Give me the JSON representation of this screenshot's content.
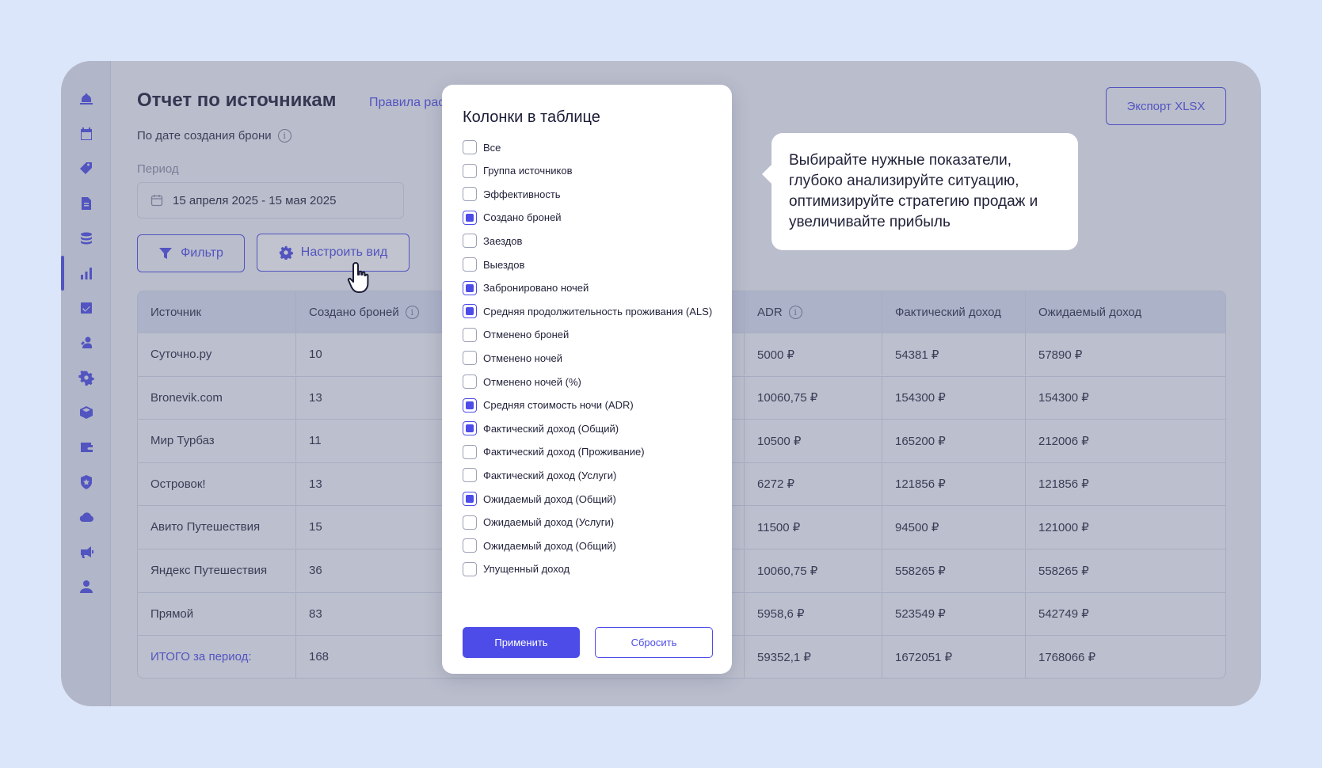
{
  "report": {
    "title": "Отчет по источникам",
    "rules_link": "Правила расч",
    "subtitle": "По дате создания брони",
    "period_label": "Период",
    "period_value": "15 апреля 2025 - 15 мая 2025",
    "filter_button": "Фильтр",
    "configure_button": "Настроить вид",
    "export_button": "Экспорт XLSX"
  },
  "sidebar": {
    "icons": [
      "bell-icon",
      "calendar-icon",
      "tag-icon",
      "document-icon",
      "coins-icon",
      "chart-icon",
      "checkbox-icon",
      "people-icon",
      "gear-icon",
      "box-icon",
      "wallet-icon",
      "badge-icon",
      "cloud-icon",
      "megaphone-icon",
      "user-icon"
    ],
    "active": "chart-icon"
  },
  "table": {
    "headers": {
      "source": "Источник",
      "created": "Создано броней",
      "adr": "ADR",
      "actual": "Фактический доход",
      "expected": "Ожидаемый доход"
    },
    "rows": [
      {
        "source": "Суточно.ру",
        "created": "10",
        "adr": "5000 ₽",
        "actual": "54381 ₽",
        "expected": "57890 ₽"
      },
      {
        "source": "Bronevik.com",
        "created": "13",
        "adr": "10060,75 ₽",
        "actual": "154300 ₽",
        "expected": "154300 ₽"
      },
      {
        "source": "Мир Турбаз",
        "created": "11",
        "adr": "10500 ₽",
        "actual": "165200 ₽",
        "expected": "212006 ₽"
      },
      {
        "source": "Островок!",
        "created": "13",
        "adr": "6272 ₽",
        "actual": "121856 ₽",
        "expected": "121856 ₽"
      },
      {
        "source": "Авито Путешествия",
        "created": "15",
        "adr": "11500 ₽",
        "actual": "94500 ₽",
        "expected": "121000 ₽"
      },
      {
        "source": "Яндекс Путешествия",
        "created": "36",
        "adr": "10060,75 ₽",
        "actual": "558265 ₽",
        "expected": "558265 ₽"
      },
      {
        "source": "Прямой",
        "created": "83",
        "adr": "5958,6 ₽",
        "actual": "523549 ₽",
        "expected": "542749 ₽"
      }
    ],
    "total": {
      "source": "ИТОГО за период:",
      "created": "168",
      "adr": "59352,1 ₽",
      "actual": "1672051 ₽",
      "expected": "1768066 ₽"
    }
  },
  "modal": {
    "title": "Колонки в таблице",
    "options": [
      {
        "label": "Все",
        "checked": false
      },
      {
        "label": "Группа источников",
        "checked": false
      },
      {
        "label": "Эффективность",
        "checked": false
      },
      {
        "label": "Создано броней",
        "checked": true
      },
      {
        "label": "Заездов",
        "checked": false
      },
      {
        "label": "Выездов",
        "checked": false
      },
      {
        "label": "Забронировано ночей",
        "checked": true
      },
      {
        "label": "Средняя продолжительность проживания (ALS)",
        "checked": true
      },
      {
        "label": "Отменено броней",
        "checked": false
      },
      {
        "label": "Отменено ночей",
        "checked": false
      },
      {
        "label": "Отменено ночей (%)",
        "checked": false
      },
      {
        "label": "Средняя стоимость ночи (ADR)",
        "checked": true
      },
      {
        "label": "Фактический доход (Общий)",
        "checked": true
      },
      {
        "label": "Фактический доход (Проживание)",
        "checked": false
      },
      {
        "label": "Фактический доход (Услуги)",
        "checked": false
      },
      {
        "label": "Ожидаемый доход (Общий)",
        "checked": true
      },
      {
        "label": "Ожидаемый доход (Услуги)",
        "checked": false
      },
      {
        "label": "Ожидаемый доход (Общий)",
        "checked": false
      },
      {
        "label": "Упущенный доход",
        "checked": false
      }
    ],
    "apply_button": "Применить",
    "reset_button": "Сбросить"
  },
  "tooltip": {
    "text": "Выбирайте нужные показатели, глубоко анализируйте ситуацию, оптимизируйте стратегию продаж и увеличивайте прибыль"
  },
  "colors": {
    "accent": "#4d4ce8",
    "background": "#dbe6fb",
    "header_row": "#dde4f5"
  }
}
